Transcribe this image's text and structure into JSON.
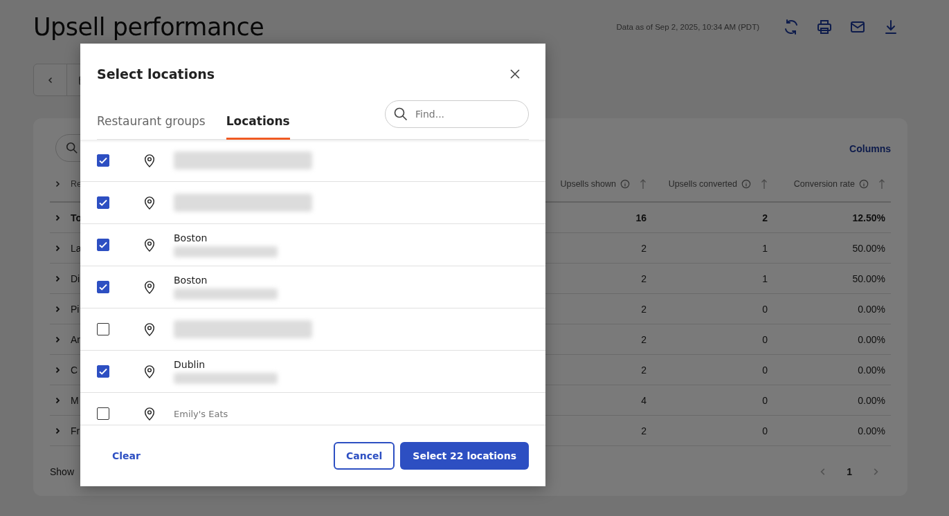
{
  "page": {
    "title": "Upsell performance",
    "data_as_of": "Data as of Sep 2, 2025, 10:34 AM (PDT)"
  },
  "table": {
    "columns_link": "Columns",
    "columns": [
      {
        "label": "Re"
      },
      {
        "label": "Upsells shown"
      },
      {
        "label": "Upsells converted"
      },
      {
        "label": "Conversion rate"
      }
    ],
    "rows": [
      {
        "kind": "total",
        "cells": [
          "To",
          "16",
          "2",
          "12.50%"
        ]
      },
      {
        "kind": "item",
        "cells": [
          "La",
          "2",
          "1",
          "50.00%"
        ]
      },
      {
        "kind": "item",
        "cells": [
          "Di",
          "2",
          "1",
          "50.00%"
        ]
      },
      {
        "kind": "item",
        "cells": [
          "Pi",
          "2",
          "0",
          "0.00%"
        ]
      },
      {
        "kind": "item",
        "cells": [
          "Ar",
          "2",
          "0",
          "0.00%"
        ]
      },
      {
        "kind": "item",
        "cells": [
          "C",
          "2",
          "0",
          "0.00%"
        ]
      },
      {
        "kind": "item",
        "cells": [
          "M",
          "4",
          "0",
          "0.00%"
        ]
      },
      {
        "kind": "item",
        "cells": [
          "Fr",
          "2",
          "0",
          "0.00%"
        ]
      }
    ],
    "show_label": "Show",
    "page": "1"
  },
  "dialog": {
    "title": "Select locations",
    "tabs": [
      {
        "label": "Restaurant groups",
        "selected": false
      },
      {
        "label": "Locations",
        "selected": true
      }
    ],
    "search": {
      "placeholder": "Find..."
    },
    "locations": [
      {
        "checked": true,
        "name_redacted": true
      },
      {
        "checked": true,
        "name_redacted": true
      },
      {
        "checked": true,
        "name": "Boston",
        "detail_redacted": true
      },
      {
        "checked": true,
        "name": "Boston",
        "detail_redacted": true
      },
      {
        "checked": false,
        "name_redacted": true
      },
      {
        "checked": true,
        "name": "Dublin",
        "detail_redacted": true
      },
      {
        "checked": false,
        "name": "Emily's Eats"
      }
    ],
    "clear": "Clear",
    "cancel": "Cancel",
    "confirm": "Select 22 locations"
  }
}
